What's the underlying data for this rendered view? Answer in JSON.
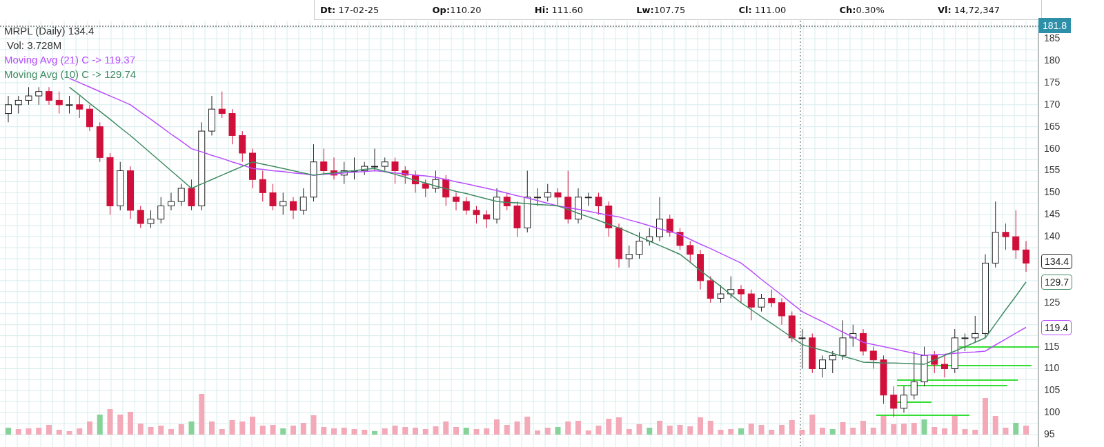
{
  "header": {
    "fields": [
      "**Dt:** 17-02-25",
      "**Op:**110.20",
      "**Hi:** 111.60",
      "**Lw:**107.75",
      "**Cl:** 111.00",
      "**Ch:**0.30%",
      "**Vl:** 14,72,347"
    ]
  },
  "legend": [
    {
      "text": "MRPL (Daily) 134.4",
      "color": "#333333"
    },
    {
      "text": "Vol: 3.728M",
      "color": "#333333"
    }
  ],
  "chart_data": {
    "type": "candlestick",
    "ylim": [
      92.2,
      189.1
    ],
    "grid": true,
    "yticks": [
      {
        "value": 185,
        "label": "185"
      },
      {
        "value": 180,
        "label": "180"
      },
      {
        "value": 175,
        "label": "175"
      },
      {
        "value": 170,
        "label": "170"
      },
      {
        "value": 165,
        "label": "165"
      },
      {
        "value": 160,
        "label": "160"
      },
      {
        "value": 155,
        "label": "155"
      },
      {
        "value": 150,
        "label": "150"
      },
      {
        "value": 145,
        "label": "145"
      },
      {
        "value": 140,
        "label": "140"
      },
      {
        "value": 125,
        "label": "125"
      },
      {
        "value": 115,
        "label": "115"
      },
      {
        "value": 110,
        "label": "110"
      },
      {
        "value": 105,
        "label": "105"
      },
      {
        "value": 100,
        "label": "100"
      },
      {
        "value": 95,
        "label": "95"
      }
    ],
    "ohlc": [
      [
        168,
        172,
        166,
        170
      ],
      [
        170,
        172,
        168,
        171
      ],
      [
        171,
        174,
        170,
        172
      ],
      [
        172,
        174,
        170,
        173
      ],
      [
        173,
        174,
        170,
        171
      ],
      [
        171,
        173,
        168,
        170
      ],
      [
        170,
        172,
        168,
        170
      ],
      [
        170,
        172,
        167,
        169
      ],
      [
        169,
        170,
        164,
        165
      ],
      [
        165,
        166,
        157,
        158
      ],
      [
        158,
        159,
        145,
        147
      ],
      [
        147,
        157,
        146,
        155
      ],
      [
        155,
        156,
        144,
        146
      ],
      [
        146,
        147,
        142,
        143
      ],
      [
        143,
        146,
        142,
        144
      ],
      [
        144,
        149,
        143,
        147
      ],
      [
        147,
        150,
        146,
        148
      ],
      [
        148,
        152,
        147,
        151
      ],
      [
        151,
        153,
        146,
        147
      ],
      [
        147,
        166,
        146,
        164
      ],
      [
        164,
        172,
        163,
        169
      ],
      [
        169,
        173,
        167,
        168
      ],
      [
        168,
        169,
        161,
        163
      ],
      [
        163,
        164,
        157,
        159
      ],
      [
        159,
        160,
        151,
        153
      ],
      [
        153,
        155,
        148,
        150
      ],
      [
        150,
        152,
        146,
        147
      ],
      [
        147,
        150,
        145,
        148
      ],
      [
        148,
        149,
        144,
        146
      ],
      [
        146,
        151,
        145,
        149
      ],
      [
        149,
        161,
        148,
        157
      ],
      [
        157,
        160,
        154,
        155
      ],
      [
        155,
        158,
        153,
        154
      ],
      [
        154,
        157,
        152,
        155
      ],
      [
        155,
        158,
        153,
        155
      ],
      [
        155,
        157,
        154,
        156
      ],
      [
        156,
        160,
        155,
        156
      ],
      [
        156,
        158,
        155,
        157
      ],
      [
        157,
        158,
        152,
        155
      ],
      [
        155,
        156,
        152,
        154
      ],
      [
        154,
        155,
        150,
        152
      ],
      [
        152,
        153,
        149,
        151
      ],
      [
        151,
        155,
        150,
        153
      ],
      [
        153,
        154,
        147,
        149
      ],
      [
        149,
        150,
        146,
        148
      ],
      [
        148,
        149,
        145,
        146
      ],
      [
        146,
        147,
        143,
        145
      ],
      [
        145,
        146,
        142,
        144
      ],
      [
        144,
        151,
        143,
        149
      ],
      [
        149,
        150,
        146,
        147
      ],
      [
        147,
        148,
        140,
        142
      ],
      [
        142,
        155,
        141,
        149
      ],
      [
        149,
        151,
        147,
        149
      ],
      [
        149,
        152,
        148,
        150
      ],
      [
        150,
        151,
        147,
        149
      ],
      [
        149,
        155,
        143,
        144
      ],
      [
        144,
        151,
        143,
        149
      ],
      [
        149,
        150,
        147,
        149
      ],
      [
        149,
        150,
        145,
        147
      ],
      [
        147,
        148,
        140,
        142
      ],
      [
        142,
        143,
        133,
        135
      ],
      [
        135,
        138,
        133,
        136
      ],
      [
        136,
        141,
        135,
        139
      ],
      [
        139,
        142,
        138,
        140
      ],
      [
        140,
        149,
        139,
        144
      ],
      [
        144,
        145,
        140,
        141
      ],
      [
        141,
        142,
        137,
        138
      ],
      [
        138,
        139,
        134,
        136
      ],
      [
        136,
        137,
        128,
        130
      ],
      [
        130,
        131,
        125,
        126
      ],
      [
        126,
        129,
        125,
        127
      ],
      [
        127,
        131,
        126,
        128
      ],
      [
        128,
        129,
        125,
        127
      ],
      [
        127,
        128,
        121,
        124
      ],
      [
        124,
        127,
        123,
        126
      ],
      [
        126,
        128,
        124,
        125
      ],
      [
        125,
        126,
        120,
        122
      ],
      [
        122,
        123,
        116,
        117
      ],
      [
        117,
        119,
        110,
        117
      ],
      [
        117,
        118,
        109,
        110
      ],
      [
        110,
        113,
        108,
        112
      ],
      [
        112,
        114,
        109,
        113
      ],
      [
        113,
        121,
        112,
        117
      ],
      [
        117,
        120,
        115,
        118
      ],
      [
        118,
        119,
        113,
        114
      ],
      [
        114,
        115,
        110,
        112
      ],
      [
        112,
        113,
        102,
        104
      ],
      [
        104,
        106,
        99,
        101
      ],
      [
        101,
        106,
        100,
        104
      ],
      [
        104,
        114,
        103,
        107
      ],
      [
        107,
        115,
        106,
        113
      ],
      [
        113,
        114,
        109,
        111
      ],
      [
        111,
        113,
        108,
        110
      ],
      [
        110,
        119,
        109,
        117
      ],
      [
        117,
        118,
        114,
        117
      ],
      [
        117,
        122,
        116,
        118
      ],
      [
        118,
        136,
        117,
        134
      ],
      [
        134,
        148,
        133,
        141
      ],
      [
        141,
        143,
        137,
        140
      ],
      [
        140,
        146,
        135,
        137
      ],
      [
        137,
        139,
        132,
        134
      ]
    ],
    "series": [
      {
        "name": "Moving Avg (21) C -> 119.37",
        "type": "line",
        "color": "#b84dff",
        "values": [
          null,
          null,
          null,
          null,
          null,
          null,
          176,
          175,
          174,
          173,
          172,
          171,
          170,
          168.3,
          166.7,
          165,
          163.3,
          161.7,
          160,
          159.3,
          158.5,
          157.8,
          157,
          156.3,
          155.5,
          155.3,
          155,
          154.8,
          154.5,
          154.3,
          154,
          154.2,
          154.3,
          154.5,
          154.7,
          154.8,
          155,
          154.8,
          154.5,
          154.3,
          154,
          153.8,
          153.5,
          153,
          152.5,
          152,
          151.5,
          151,
          150.5,
          149.9,
          149.3,
          148.8,
          148.2,
          147.6,
          147,
          146.6,
          146.2,
          145.8,
          145.3,
          144.9,
          144.5,
          143.8,
          143.2,
          142.5,
          141.8,
          141.2,
          140.5,
          139.4,
          138.3,
          137.3,
          136.2,
          135.1,
          134,
          132.2,
          130.3,
          128.5,
          126.7,
          124.8,
          123,
          121.8,
          120.7,
          119.5,
          118.3,
          117.2,
          116,
          115.5,
          115,
          114.5,
          114,
          113.5,
          113,
          113.2,
          113.3,
          113.5,
          113.7,
          113.8,
          114,
          115.4,
          116.7,
          118.1,
          119.4
        ]
      },
      {
        "name": "Moving Avg (10) C -> 129.74",
        "type": "line",
        "color": "#3f8a62",
        "values": [
          null,
          null,
          null,
          null,
          null,
          null,
          174,
          172.2,
          170.3,
          168.5,
          166.7,
          164.8,
          163,
          161,
          159,
          157,
          155,
          153,
          151,
          152,
          153,
          154,
          155,
          156,
          157,
          156.5,
          156,
          155.5,
          155,
          154.5,
          154,
          154.3,
          154.5,
          154.8,
          155,
          155.3,
          155.5,
          154.8,
          154.2,
          153.5,
          152.8,
          152.2,
          151.5,
          150.9,
          150.3,
          149.8,
          149.2,
          148.6,
          148,
          147.8,
          147.7,
          147.5,
          147.3,
          147.2,
          147,
          146.2,
          145.3,
          144.5,
          143.7,
          142.8,
          142,
          141,
          140,
          139,
          138,
          137,
          136,
          134.2,
          132.3,
          130.5,
          128.7,
          126.8,
          125,
          123.4,
          121.8,
          120.3,
          118.7,
          117.1,
          115.5,
          114.8,
          114.2,
          113.5,
          112.8,
          112.2,
          111.5,
          111.4,
          111.3,
          111.3,
          111.2,
          111.1,
          111,
          112,
          113,
          114,
          115,
          116,
          117,
          120.2,
          123.4,
          126.5,
          129.7
        ]
      }
    ]
  },
  "badges": [
    {
      "kind": "top",
      "text": "181.8",
      "color": "#2e8fa8"
    },
    {
      "kind": "last",
      "text": "134.4",
      "color": "#222222"
    },
    {
      "kind": "ma10",
      "text": "129.7",
      "color": "#3f8a62"
    },
    {
      "kind": "ma21",
      "text": "119.4",
      "color": "#b84dff"
    }
  ]
}
